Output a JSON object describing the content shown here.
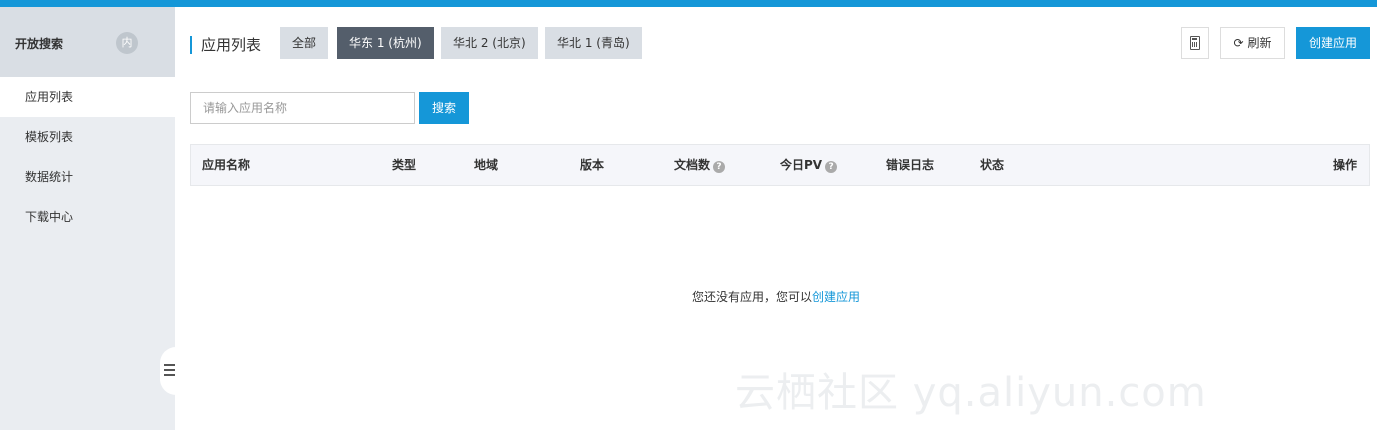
{
  "sidebar": {
    "title": "开放搜索",
    "badge": "内",
    "items": [
      {
        "label": "应用列表",
        "active": true
      },
      {
        "label": "模板列表",
        "active": false
      },
      {
        "label": "数据统计",
        "active": false
      },
      {
        "label": "下载中心",
        "active": false
      }
    ]
  },
  "header": {
    "title": "应用列表",
    "regions": [
      {
        "label": "全部",
        "active": false
      },
      {
        "label": "华东 1 (杭州)",
        "active": true
      },
      {
        "label": "华北 2 (北京)",
        "active": false
      },
      {
        "label": "华北 1 (青岛)",
        "active": false
      }
    ],
    "refresh_label": "刷新",
    "create_label": "创建应用"
  },
  "search": {
    "placeholder": "请输入应用名称",
    "value": "",
    "button_label": "搜索"
  },
  "table": {
    "columns": [
      "应用名称",
      "类型",
      "地域",
      "版本",
      "文档数",
      "今日PV",
      "错误日志",
      "状态",
      "操作"
    ],
    "rows": []
  },
  "empty": {
    "text": "您还没有应用，您可以",
    "link": "创建应用"
  },
  "watermark": "云栖社区 yq.aliyun.com",
  "colors": {
    "accent": "#1597d8",
    "active_tab": "#545e6b",
    "sidebar_bg": "#eaedf1"
  }
}
